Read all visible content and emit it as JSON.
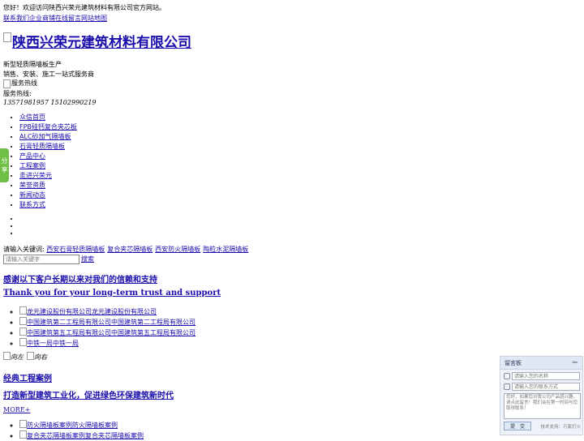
{
  "header": {
    "welcome": "您好！欢迎访问陕西兴荣元建筑材料有限公司官方网站。",
    "top_links": [
      "联系我们",
      "企业商铺",
      "在线留言",
      "网站地图"
    ],
    "logo_text": "陕西兴荣元建筑材料有限公司",
    "slogan_line1": "新型轻质隔墙板生产",
    "slogan_line2": "销售、安装、施工一站式服务商",
    "hotline_img_alt": "服务热线",
    "hotline_label": "服务热线:",
    "hotline_numbers": "13571981957 15102990219"
  },
  "nav": {
    "items": [
      {
        "label": "众信首页"
      },
      {
        "label": "FPB硅钙复合夹芯板"
      },
      {
        "label": "ALC砂加气隔墙板"
      },
      {
        "label": "石膏轻质隔墙板"
      },
      {
        "label": "产品中心"
      },
      {
        "label": "工程案例"
      },
      {
        "label": "走进兴荣元"
      },
      {
        "label": "荣誉资质"
      },
      {
        "label": "新闻动态"
      },
      {
        "label": "联系方式"
      }
    ]
  },
  "share": {
    "label_top": "分",
    "label_bottom": "享"
  },
  "search": {
    "keywords_label": "请输入关键词:",
    "keywords": [
      "西安石膏轻质隔墙板",
      "复合夹芯隔墙板",
      "西安防火隔墙板",
      "陶粒水泥隔墙板"
    ],
    "placeholder": "请输入关键字",
    "button": "搜索"
  },
  "clients_section": {
    "title_cn": "感谢以下客户长期以来对我们的信赖和支持",
    "title_en": "Thank you for your long-term trust and support",
    "items": [
      {
        "alt": "龙元建设股份有限公司",
        "name": "龙元建设股份有限公司"
      },
      {
        "alt": "中国建筑第二工程局有限公司",
        "name": "中国建筑第二工程局有限公司"
      },
      {
        "alt": "中国建筑第五工程局有限公司",
        "name": "中国建筑第五工程局有限公司"
      },
      {
        "alt": "中铁一局",
        "name": "中铁一局"
      }
    ],
    "prev_alt": "向左",
    "next_alt": "向右"
  },
  "cases_section": {
    "title": "经典工程案例",
    "subtitle": "打造新型建筑工业化，促进绿色环保建筑新时代",
    "more": "MORE+",
    "items": [
      {
        "alt": "防火隔墙板案例",
        "name": "防火隔墙板案例"
      },
      {
        "alt": "复合夹芯隔墙板案例",
        "name": "复合夹芯隔墙板案例"
      }
    ]
  },
  "message_board": {
    "title": "留言板",
    "minimize": "−",
    "name_placeholder": "请输入您的名称",
    "contact_placeholder": "请输入您的联系方式",
    "message_placeholder": "您好，如果您对我公司产品感兴趣，请点此留言！我们会在第一时间与您取得联系！",
    "submit": "提　交",
    "tech_support": "技术支持：万家灯火"
  }
}
